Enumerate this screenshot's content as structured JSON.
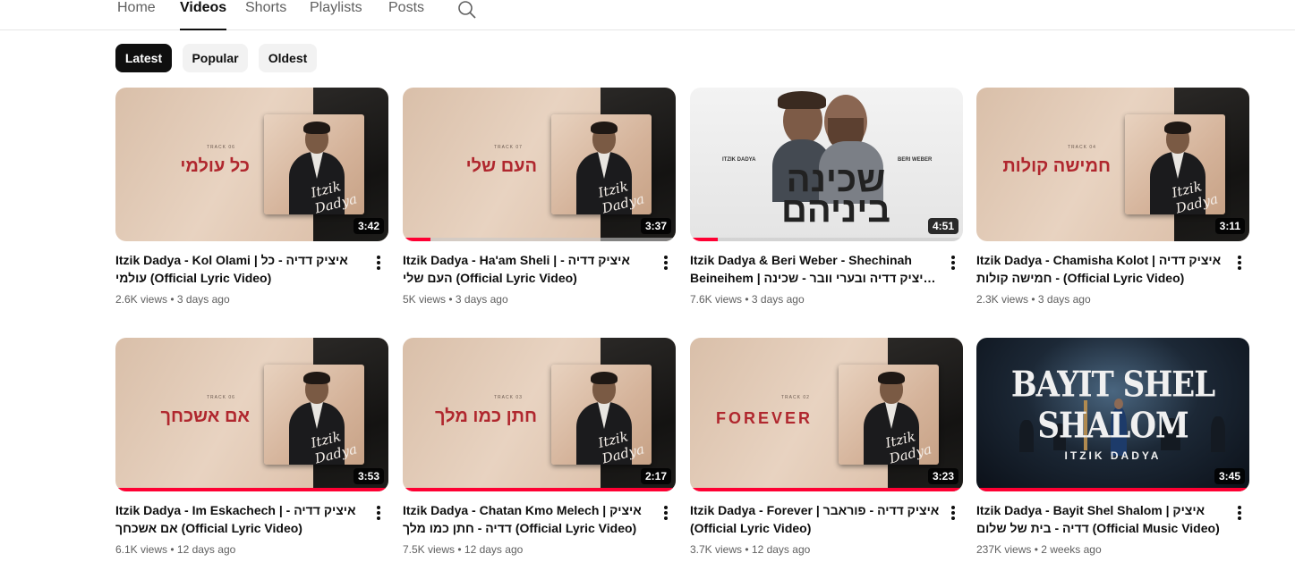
{
  "tabs": [
    {
      "label": "Home"
    },
    {
      "label": "Videos"
    },
    {
      "label": "Shorts"
    },
    {
      "label": "Playlists"
    },
    {
      "label": "Posts"
    }
  ],
  "active_tab": "Videos",
  "search_icon": "search-icon",
  "filters": [
    {
      "label": "Latest",
      "selected": true
    },
    {
      "label": "Popular",
      "selected": false
    },
    {
      "label": "Oldest",
      "selected": false
    }
  ],
  "colors": {
    "accent": "#ff0033",
    "title_red": "#b0272e",
    "chip_bg": "#f2f2f2",
    "chip_selected_bg": "#0f0f0f"
  },
  "videos": [
    {
      "title": "Itzik Dadya - Kol Olami | איציק דדיה - כל עולמי (Official Lyric Video)",
      "views": "2.6K views",
      "age": "3 days ago",
      "duration": "3:42",
      "thumb_text": "כל עולמי",
      "track_label": "TRACK 06",
      "watched": 0
    },
    {
      "title": "Itzik Dadya - Ha'am Sheli | איציק דדיה - העם שלי (Official Lyric Video)",
      "views": "5K views",
      "age": "3 days ago",
      "duration": "3:37",
      "thumb_text": "העם שלי",
      "track_label": "TRACK 07",
      "watched": 0.1
    },
    {
      "title": "Itzik Dadya & Beri Weber - Shechinah Beineihem | איציק דדיה ובערי וובר - שכינה ביניהם…",
      "views": "7.6K views",
      "age": "3 days ago",
      "duration": "4:51",
      "thumb_text": "שכינה ביניהם",
      "names": [
        "ITZIK DADYA",
        "BERI WEBER"
      ],
      "watched": 0.1
    },
    {
      "title": "Itzik Dadya - Chamisha Kolot | איציק דדיה - חמישה קולות (Official Lyric Video)",
      "views": "2.3K views",
      "age": "3 days ago",
      "duration": "3:11",
      "thumb_text": "חמישה קולות",
      "track_label": "TRACK 04",
      "watched": 0
    },
    {
      "title": "Itzik Dadya - Im Eskachech | איציק דדיה - אם אשכחך (Official Lyric Video)",
      "views": "6.1K views",
      "age": "12 days ago",
      "duration": "3:53",
      "thumb_text": "אם אשכחך",
      "track_label": "TRACK 06",
      "watched": 1
    },
    {
      "title": "Itzik Dadya - Chatan Kmo Melech | איציק דדיה - חתן כמו מלך (Official Lyric Video)",
      "views": "7.5K views",
      "age": "12 days ago",
      "duration": "2:17",
      "thumb_text": "חתן כמו מלך",
      "track_label": "TRACK 03",
      "watched": 1
    },
    {
      "title": "Itzik Dadya - Forever | איציק דדיה - פוראבר (Official Lyric Video)",
      "views": "3.7K views",
      "age": "12 days ago",
      "duration": "3:23",
      "thumb_text": "FOREVER",
      "track_label": "TRACK 02",
      "watched": 1
    },
    {
      "title": "Itzik Dadya - Bayit Shel Shalom | איציק דדיה - בית של שלום (Official Music Video)",
      "views": "237K views",
      "age": "2 weeks ago",
      "duration": "3:45",
      "thumb_text": "BAYIT SHEL SHALOM",
      "thumb_subtext": "ITZIK DADYA",
      "watched": 1
    }
  ],
  "menu_icon": "more-vertical-icon"
}
